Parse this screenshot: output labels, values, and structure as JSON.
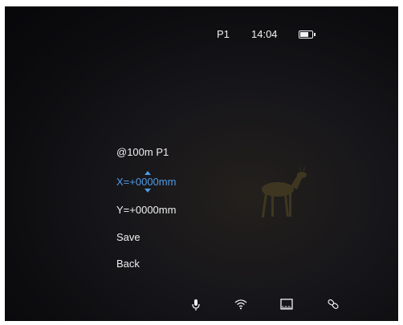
{
  "status_bar": {
    "profile": "P1",
    "time": "14:04",
    "battery_icon": "battery-icon",
    "battery_level": 0.75
  },
  "menu": {
    "distance_profile": "@100m   P1",
    "x_adjust": "X=+0000mm",
    "y_adjust": "Y=+0000mm",
    "save": "Save",
    "back": "Back",
    "selected_item": "x_adjust",
    "accent_color": "#4d9be6"
  },
  "bottom_icons": [
    "microphone-icon",
    "wifi-icon",
    "ruler-icon",
    "link-icon"
  ],
  "colors": {
    "background": "#0d0d10",
    "text": "#f0f0f0"
  }
}
